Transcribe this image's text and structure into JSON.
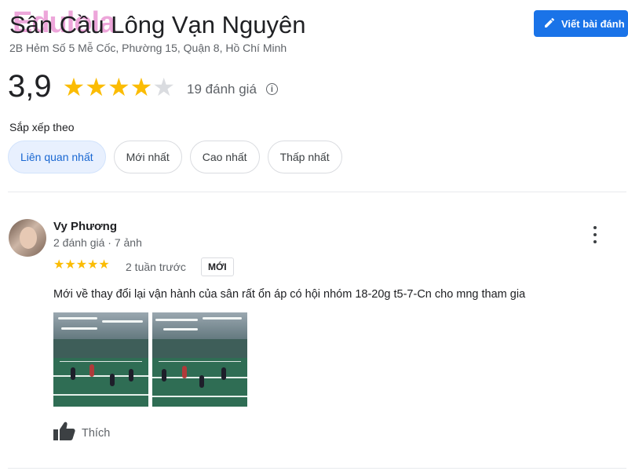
{
  "header": {
    "watermark": "Edulola",
    "title": "Sân Cầu Lông Vạn Nguyên",
    "address": "2B Hẻm Số 5 Mễ Cốc, Phường 15, Quận 8, Hồ Chí Minh",
    "write_review_label": "Viết bài đánh",
    "write_review_icon": "pencil-icon"
  },
  "rating": {
    "value": "3,9",
    "stars_filled": 4,
    "stars_total": 5,
    "count_label": "19 đánh giá",
    "info_icon": "info-icon"
  },
  "sort": {
    "label": "Sắp xếp theo",
    "options": [
      {
        "label": "Liên quan nhất",
        "active": true
      },
      {
        "label": "Mới nhất",
        "active": false
      },
      {
        "label": "Cao nhất",
        "active": false
      },
      {
        "label": "Thấp nhất",
        "active": false
      }
    ]
  },
  "review": {
    "author": "Vy Phương",
    "meta": "2 đánh giá · 7 ảnh",
    "stars": 5,
    "time": "2 tuần trước",
    "badge": "MỚI",
    "text": "Mới về thay đổi lại vận hành của sân rất ổn áp có hội nhóm 18-20g t5-7-Cn cho mng tham gia",
    "photos": [
      "badminton-court-photo-1",
      "badminton-court-photo-2"
    ],
    "like_label": "Thích",
    "like_icon": "thumbs-up-icon",
    "more_icon": "more-vert-icon"
  },
  "colors": {
    "accent": "#1a73e8",
    "star": "#fbbc04",
    "star_empty": "#dadce0",
    "watermark": "#df5dbc"
  }
}
